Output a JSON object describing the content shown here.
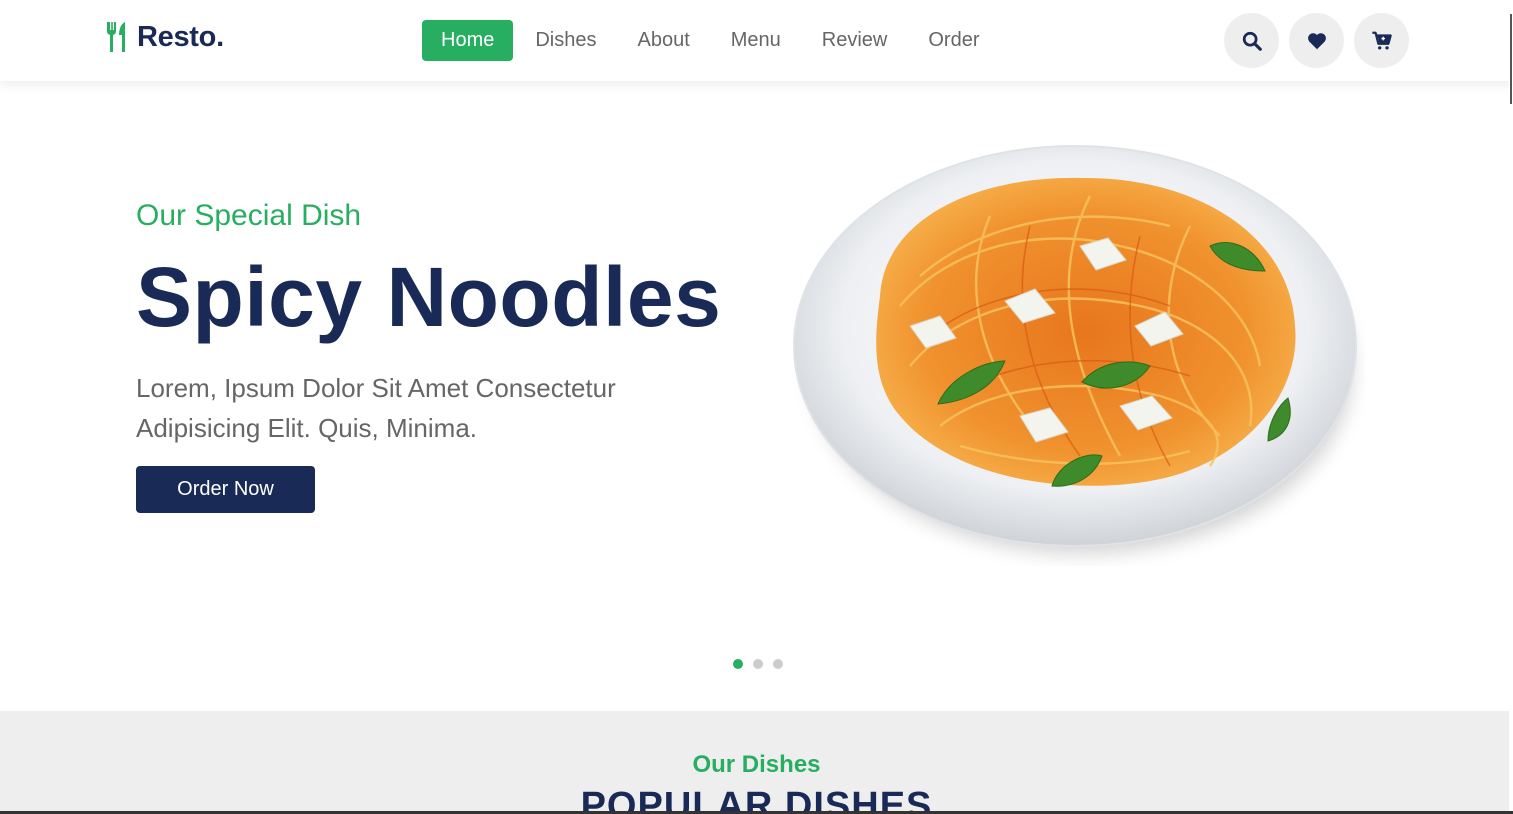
{
  "header": {
    "logo_text": "Resto.",
    "nav": [
      {
        "label": "Home",
        "active": true
      },
      {
        "label": "Dishes",
        "active": false
      },
      {
        "label": "About",
        "active": false
      },
      {
        "label": "Menu",
        "active": false
      },
      {
        "label": "Review",
        "active": false
      },
      {
        "label": "Order",
        "active": false
      }
    ],
    "icons": [
      "search-icon",
      "heart-icon",
      "cart-icon"
    ]
  },
  "hero": {
    "subtitle": "Our Special Dish",
    "title": "Spicy Noodles",
    "description": "Lorem, Ipsum Dolor Sit Amet Consectetur Adipisicing Elit. Quis, Minima.",
    "button_label": "Order Now",
    "slides": {
      "count": 3,
      "active_index": 0
    }
  },
  "dishes_section": {
    "subtitle": "Our Dishes",
    "title": "POPULAR DISHES"
  },
  "colors": {
    "accent_green": "#27ae60",
    "navy": "#192a56",
    "text_gray": "#666666",
    "icon_bg": "#eeeeee"
  }
}
